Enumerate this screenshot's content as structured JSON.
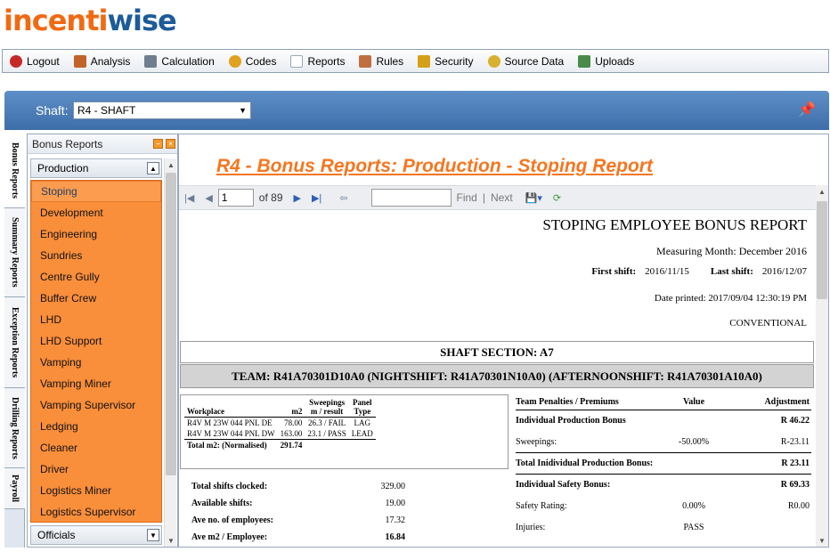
{
  "logo": {
    "part1": "incenti",
    "part2": "wise"
  },
  "menu": [
    {
      "label": "Logout",
      "icon": "logout-icon",
      "color": "#c62828"
    },
    {
      "label": "Analysis",
      "icon": "analysis-icon",
      "color": "#c0642a"
    },
    {
      "label": "Calculation",
      "icon": "calculator-icon",
      "color": "#6f7f8f"
    },
    {
      "label": "Codes",
      "icon": "codes-icon",
      "color": "#e0a020"
    },
    {
      "label": "Reports",
      "icon": "reports-icon",
      "color": "#9aa8b8"
    },
    {
      "label": "Rules",
      "icon": "rules-icon",
      "color": "#c07040"
    },
    {
      "label": "Security",
      "icon": "security-icon",
      "color": "#d4a017"
    },
    {
      "label": "Source Data",
      "icon": "source-data-icon",
      "color": "#d8b030"
    },
    {
      "label": "Uploads",
      "icon": "uploads-icon",
      "color": "#4a8a4a"
    }
  ],
  "shaft": {
    "label": "Shaft:",
    "value": "R4 - SHAFT"
  },
  "vtabs": [
    "Bonus Reports",
    "Summary Reports",
    "Exception Reports",
    "Drilling Reports",
    "Payroll"
  ],
  "nav": {
    "header": "Bonus Reports",
    "group": "Production",
    "items": [
      "Stoping",
      "Development",
      "Engineering",
      "Sundries",
      "Centre Gully",
      "Buffer Crew",
      "LHD",
      "LHD Support",
      "Vamping",
      "Vamping Miner",
      "Vamping Supervisor",
      "Ledging",
      "Cleaner",
      "Driver",
      "Logistics Miner",
      "Logistics Supervisor"
    ],
    "group2": "Officials"
  },
  "content": {
    "title": "R4 - Bonus Reports: Production - Stoping Report",
    "toolbar": {
      "page": "1",
      "of": "of 89",
      "find": "Find",
      "sep": "|",
      "next": "Next"
    }
  },
  "report": {
    "title": "STOPING EMPLOYEE BONUS REPORT",
    "month": "Measuring Month: December 2016",
    "first_label": "First shift:",
    "first_value": "2016/11/15",
    "last_label": "Last shift:",
    "last_value": "2016/12/07",
    "printed": "Date printed: 2017/09/04 12:30:19 PM",
    "type": "CONVENTIONAL",
    "section": "SHAFT SECTION: A7",
    "team": "TEAM: R41A70301D10A0 (NIGHTSHIFT: R41A70301N10A0) (AFTERNOONSHIFT: R41A70301A10A0)",
    "wp_headers": {
      "workplace": "Workplace",
      "m2": "m2",
      "sweep1": "Sweepings",
      "sweep2": "m / result",
      "panel1": "Panel",
      "panel2": "Type"
    },
    "wp_rows": [
      {
        "workplace": "R4V M 23W 044  PNL  DE",
        "m2": "78.00",
        "sweep": "26.3 / FAIL",
        "panel": "LAG"
      },
      {
        "workplace": "R4V M 23W 044  PNL  DW",
        "m2": "163.00",
        "sweep": "23.1 / PASS",
        "panel": "LEAD"
      }
    ],
    "wp_total_label": "Total m2: (Normalised)",
    "wp_total_value": "291.74",
    "stats": [
      {
        "label": "Total shifts clocked:",
        "value": "329.00"
      },
      {
        "label": "Available shifts:",
        "value": "19.00"
      },
      {
        "label": "Ave no. of employees:",
        "value": "17.32"
      },
      {
        "label": "Ave m2 / Employee:",
        "value": "16.84"
      }
    ],
    "pen_headers": {
      "c1": "Team Penalties / Premiums",
      "c2": "Value",
      "c3": "Adjustment"
    },
    "pen_rows": [
      {
        "c1": "Individual Production Bonus",
        "c2": "",
        "c3": "R 46.22",
        "bold": true
      },
      {
        "c1": "Sweepings:",
        "c2": "-50.00%",
        "c3": "R-23.11",
        "bold": false
      },
      {
        "c1": "Total Inidividual Production Bonus:",
        "c2": "",
        "c3": "R 23.11",
        "bold": true
      },
      {
        "c1": "Individual Safety Bonus:",
        "c2": "",
        "c3": "R 69.33",
        "bold": true
      },
      {
        "c1": "Safety Rating:",
        "c2": "0.00%",
        "c3": "R0.00",
        "bold": false
      },
      {
        "c1": "Injuries:",
        "c2": "PASS",
        "c3": "",
        "bold": false
      }
    ]
  }
}
